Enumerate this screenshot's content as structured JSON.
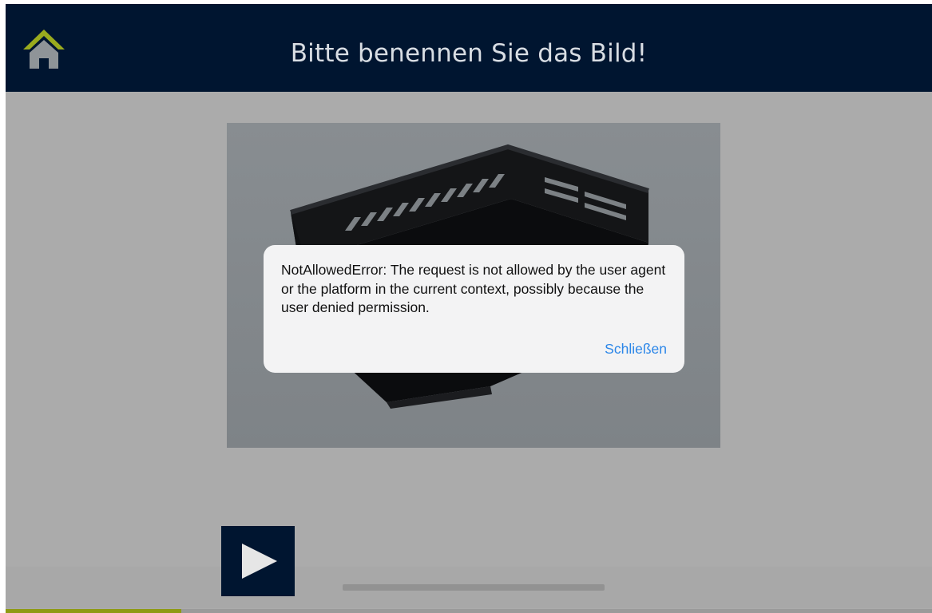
{
  "header": {
    "title": "Bitte benennen Sie das Bild!",
    "home_icon": "home-icon",
    "background": "#001530",
    "home_roof_color": "#9aab1e"
  },
  "picture": {
    "subject_icon": "storage-crate-image"
  },
  "player": {
    "play_icon": "play-icon",
    "progress": 0.0,
    "lesson_progress": 0.19
  },
  "alert": {
    "message": "NotAllowedError: The request is not allowed by the user agent or the platform in the current context, possibly because the user denied permission.",
    "close_label": "Schließen",
    "link_color": "#2b86e8"
  }
}
